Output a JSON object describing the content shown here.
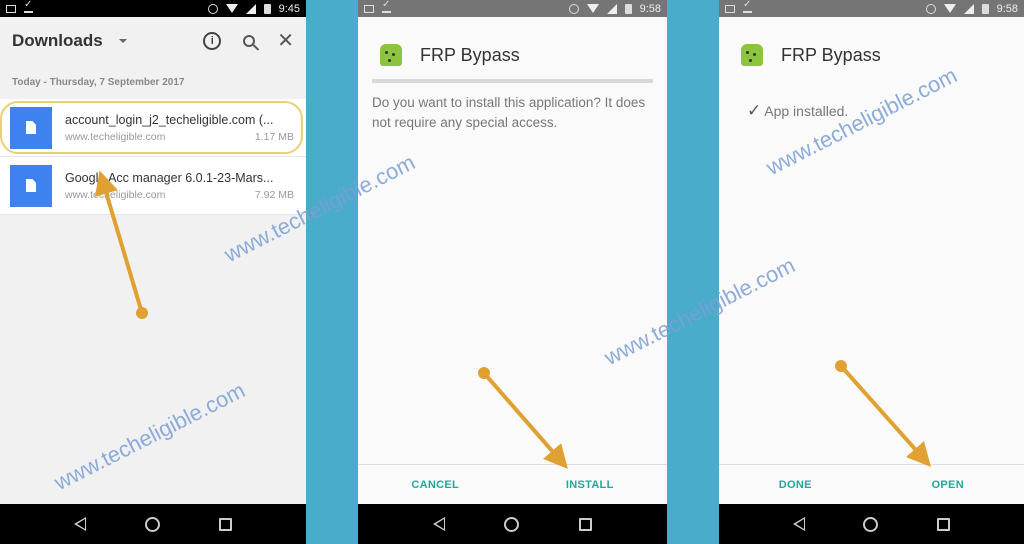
{
  "panels": [
    {
      "statusbar": {
        "time": "9:45"
      },
      "header": {
        "title": "Downloads"
      },
      "date_label": "Today - Thursday, 7 September 2017",
      "items": [
        {
          "name": "account_login_j2_techeligible.com (...",
          "source": "www.techeligible.com",
          "size": "1.17 MB",
          "highlighted": true
        },
        {
          "name": "Google Acc manager 6.0.1-23-Mars...",
          "source": "www.techeligible.com",
          "size": "7.92 MB",
          "highlighted": false
        }
      ]
    },
    {
      "statusbar": {
        "time": "9:58"
      },
      "app_name": "FRP Bypass",
      "message": "Do you want to install this application? It does not require any special access.",
      "buttons": {
        "cancel": "CANCEL",
        "install": "INSTALL"
      }
    },
    {
      "statusbar": {
        "time": "9:58"
      },
      "app_name": "FRP Bypass",
      "status": "App installed.",
      "buttons": {
        "done": "DONE",
        "open": "OPEN"
      }
    }
  ],
  "watermark": "www.techeligible.com",
  "colors": {
    "accent": "#26a69a",
    "file_icon": "#3e82f0",
    "arrow": "#e0a032",
    "background": "#4aaccb"
  }
}
